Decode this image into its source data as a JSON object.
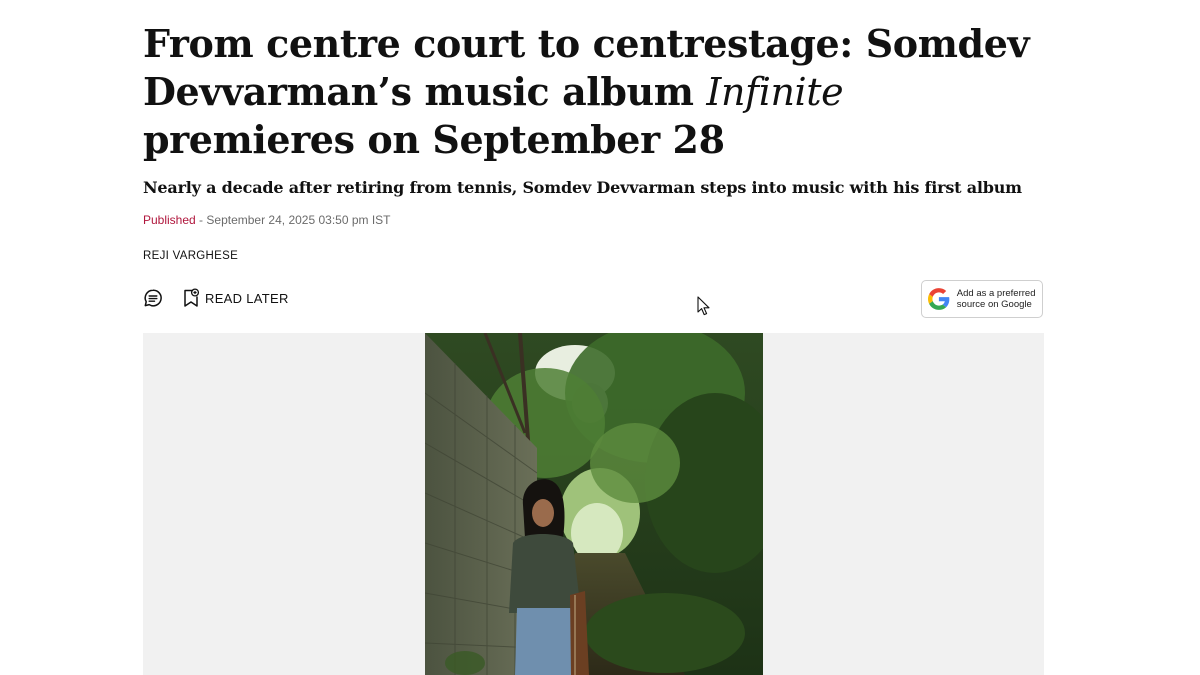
{
  "article": {
    "headline_part1": "From centre court to centrestage: Somdev Devvarman’s music album ",
    "headline_italic": "Infinite",
    "headline_part2": " premieres on September 28",
    "subhead": "Nearly a decade after retiring from tennis, Somdev Devvarman steps into music with his first album",
    "published_label": "Published",
    "published_separator": " - ",
    "published_date": "September 24, 2025 03:50 pm IST",
    "author": "REJI VARGHESE"
  },
  "actions": {
    "comment_icon": "comment-icon",
    "read_later_icon": "bookmark-add-icon",
    "read_later_label": "READ LATER"
  },
  "google_source": {
    "icon": "google-g-icon",
    "line1": "Add as a preferred",
    "line2": "source on Google"
  },
  "colors": {
    "published": "#b0163c",
    "meta_text": "#6b6b6b",
    "image_band_bg": "#f1f1f1"
  }
}
